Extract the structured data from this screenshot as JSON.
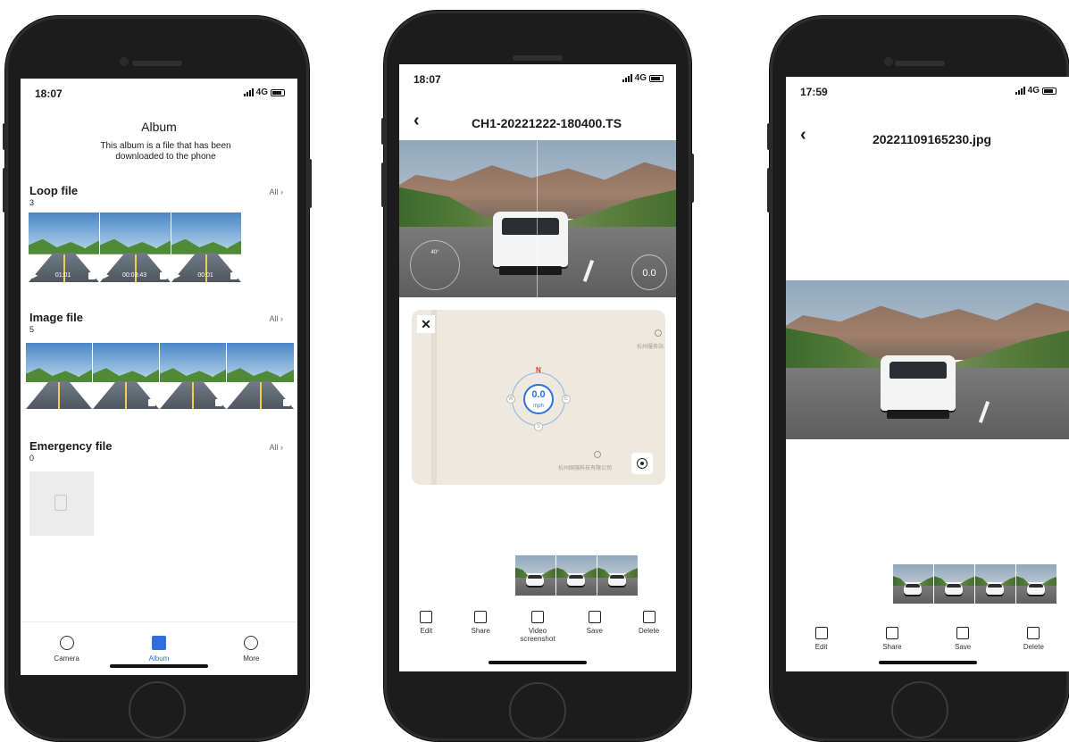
{
  "phone1": {
    "time": "18:07",
    "network": "4G",
    "title": "Album",
    "subtitle": "This album is a file that has been downloaded to the phone",
    "sections": [
      {
        "name": "Loop file",
        "count": "3",
        "all_label": "All"
      },
      {
        "name": "Image file",
        "count": "5",
        "all_label": "All"
      },
      {
        "name": "Emergency file",
        "count": "0",
        "all_label": "All"
      }
    ],
    "loop_tiles": [
      {
        "duration": "01:01"
      },
      {
        "duration": "00:03:43"
      },
      {
        "duration": "00:01"
      }
    ],
    "tabs": [
      {
        "label": "Camera",
        "icon": "camera-icon"
      },
      {
        "label": "Album",
        "icon": "album-icon"
      },
      {
        "label": "More",
        "icon": "more-icon"
      }
    ],
    "active_tab": "Album",
    "accent": "#2f6fe0"
  },
  "phone2": {
    "time": "18:07",
    "network": "4G",
    "title": "CH1-20221222-180400.TS",
    "speed_overlay": "0.0",
    "angle_overlay": "40°",
    "compass": {
      "north": "N",
      "speed": "0.0",
      "unit": "mph",
      "west": "W",
      "east": "E",
      "south": "S"
    },
    "map_labels": [
      "杭州服务站",
      "杭州国强科技有限公司"
    ],
    "tools": [
      {
        "label": "Edit",
        "icon": "edit-icon"
      },
      {
        "label": "Share",
        "icon": "share-icon"
      },
      {
        "label": "Video screenshot",
        "icon": "camera-icon"
      },
      {
        "label": "Save",
        "icon": "save-icon"
      },
      {
        "label": "Delete",
        "icon": "delete-icon"
      }
    ]
  },
  "phone3": {
    "time": "17:59",
    "network": "4G",
    "title": "20221109165230.jpg",
    "tools": [
      {
        "label": "Edit",
        "icon": "edit-icon"
      },
      {
        "label": "Share",
        "icon": "share-icon"
      },
      {
        "label": "Save",
        "icon": "save-icon"
      },
      {
        "label": "Delete",
        "icon": "delete-icon"
      }
    ]
  }
}
